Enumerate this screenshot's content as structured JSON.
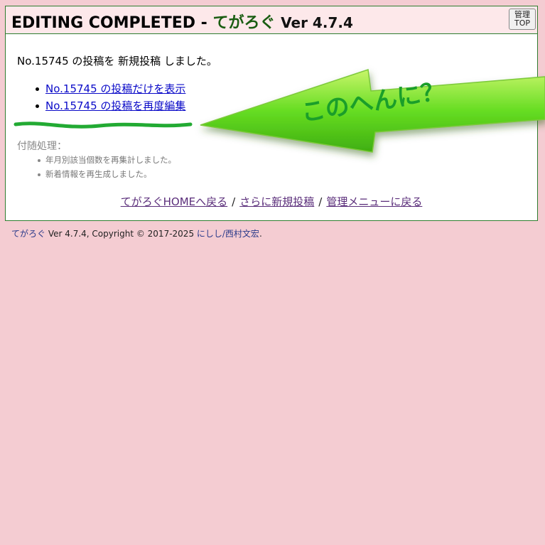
{
  "header": {
    "title": "EDITING COMPLETED -",
    "app_name": "てがろぐ",
    "version": "Ver 4.7.4",
    "admin_button": {
      "line1": "管理",
      "line2": "TOP"
    }
  },
  "message": "No.15745 の投稿を 新規投稿 しました。",
  "links": [
    "No.15745 の投稿だけを表示",
    "No.15745 の投稿を再度編集"
  ],
  "post_process": {
    "label": "付随処理：",
    "items": [
      "年月別該当個数を再集計しました。",
      "新着情報を再生成しました。"
    ]
  },
  "footer_links": {
    "home": "てがろぐHOMEへ戻る",
    "new_post": "さらに新規投稿",
    "admin_menu": "管理メニューに戻る",
    "separator": "/"
  },
  "copyright": {
    "app": "てがろぐ",
    "text": " Ver 4.7.4, Copyright © 2017-2025 ",
    "author": "にしし/西村文宏",
    "end": "."
  },
  "annotation": {
    "text": "このへんに？",
    "colors": {
      "arrow": "#66dd22",
      "underline": "#22aa33",
      "text": "#1a9e2a"
    }
  }
}
